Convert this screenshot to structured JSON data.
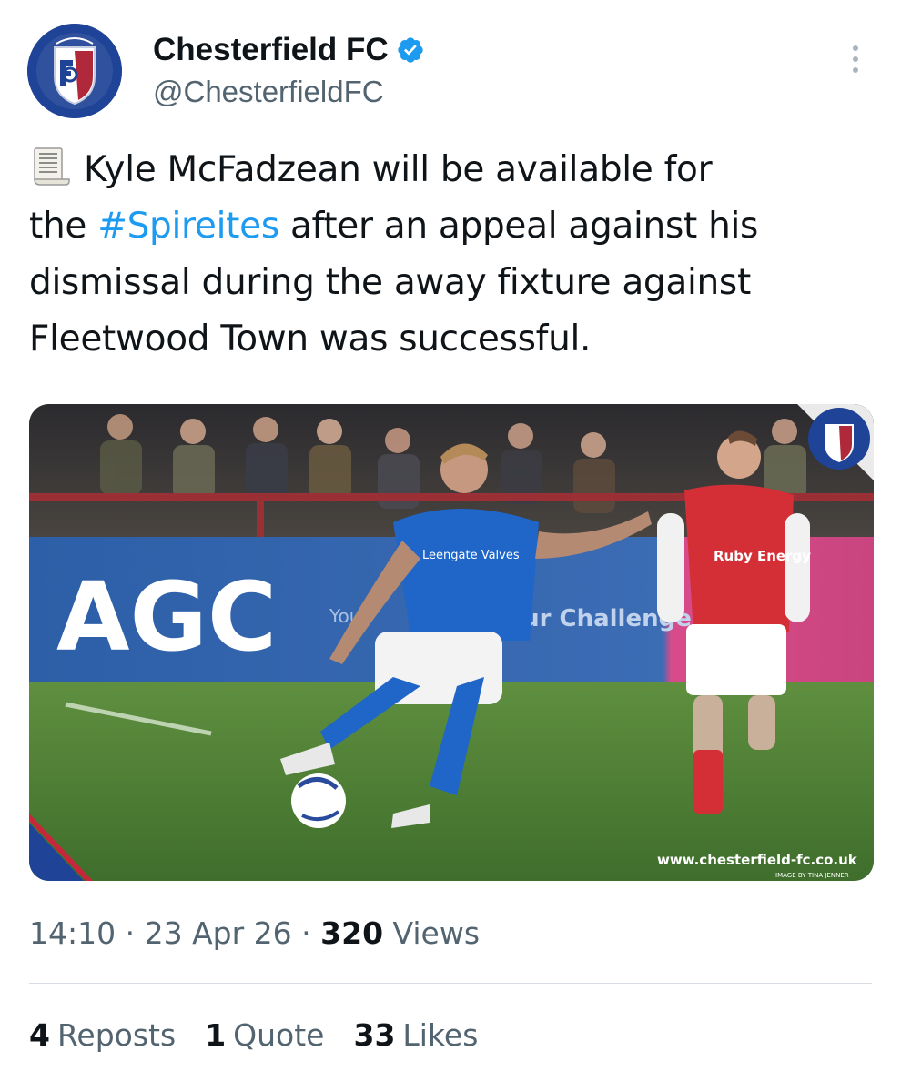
{
  "account": {
    "display_name": "Chesterfield FC",
    "handle": "@ChesterfieldFC",
    "verified": true,
    "avatar_icon": "chesterfield-crest-icon",
    "avatar_bg": "#1f4396",
    "verified_color": "#1d9bf0"
  },
  "tweet": {
    "emoji_icon": "scroll-icon",
    "line1": "Kyle McFadzean will be available for",
    "line2_prefix": "the ",
    "hashtag": "#Spireites",
    "line2_suffix": " after an appeal against his",
    "line3": "dismissal during the away fixture against",
    "line4": "Fleetwood Town was successful."
  },
  "media": {
    "hoarding_text": "AGC",
    "hoarding_small_1": "Your",
    "hoarding_small_2": "Our Challenge",
    "shirt_sponsor": "Leengate Valves",
    "opponent_sponsor": "Ruby Energy",
    "watermark": "www.chesterfield-fc.co.uk",
    "credit": "IMAGE BY TINA JENNER",
    "crest_label": "CHESTERFIELD FC"
  },
  "meta": {
    "time": "14:10",
    "sep1": " · ",
    "date": "23 Apr 26",
    "sep2": " · ",
    "views_count": "320",
    "views_label": " Views"
  },
  "stats": {
    "reposts_count": "4",
    "reposts_label": "Reposts",
    "quotes_count": "1",
    "quotes_label": "Quote",
    "likes_count": "33",
    "likes_label": "Likes"
  },
  "colors": {
    "text": "#0f1419",
    "muted": "#536471",
    "link": "#1d9bf0",
    "divider": "#d7dde2"
  }
}
